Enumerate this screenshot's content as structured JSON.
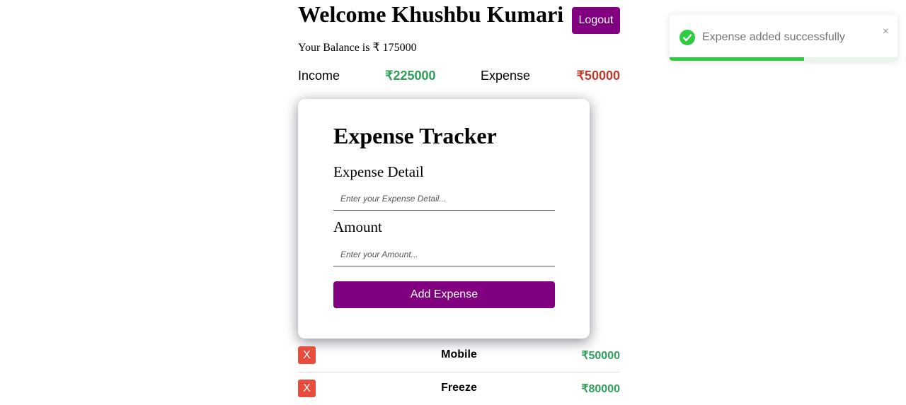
{
  "header": {
    "welcome": "Welcome Khushbu Kumari",
    "logout_label": "Logout",
    "balance_text": "Your Balance is ₹ 175000"
  },
  "summary": {
    "income_label": "Income",
    "income_value": "₹225000",
    "expense_label": "Expense",
    "expense_value": "₹50000"
  },
  "form": {
    "title": "Expense Tracker",
    "detail_label": "Expense Detail",
    "detail_placeholder": "Enter your Expense Detail...",
    "detail_value": "",
    "amount_label": "Amount",
    "amount_placeholder": "Enter your Amount...",
    "amount_value": "",
    "submit_label": "Add Expense"
  },
  "expenses": [
    {
      "delete_label": "X",
      "name": "Mobile",
      "amount": "₹50000"
    },
    {
      "delete_label": "X",
      "name": "Freeze",
      "amount": "₹80000"
    }
  ],
  "toast": {
    "message": "Expense added successfully",
    "close_label": "×",
    "icon": "check-circle-icon",
    "progress": 0.59
  },
  "colors": {
    "accent": "#800080",
    "income": "#2e9e5a",
    "expense": "#c0392b",
    "delete": "#e74c3c",
    "success": "#2ecc40"
  }
}
